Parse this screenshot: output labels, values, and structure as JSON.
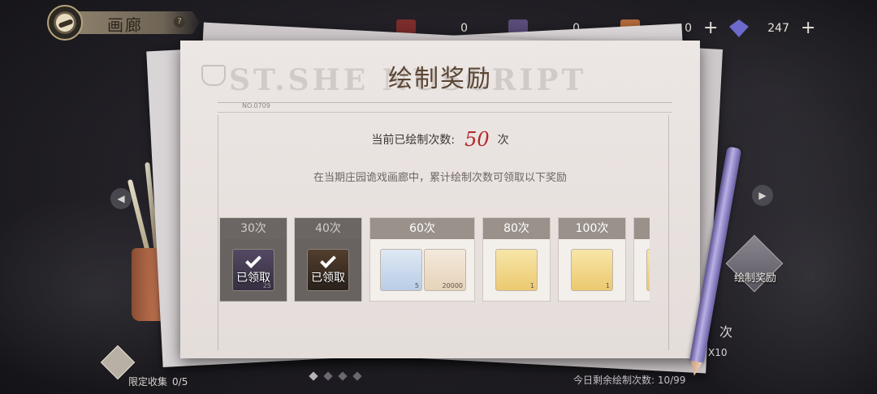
{
  "header": {
    "title": "画廊",
    "help_label": "?"
  },
  "currencies": [
    {
      "icon": "red-box-icon",
      "value": "0",
      "color": "#7a2d2a"
    },
    {
      "icon": "purple-card-icon",
      "value": "0",
      "color": "#5a4b78"
    },
    {
      "icon": "orange-card-icon",
      "value": "0",
      "color": "#b3693a"
    },
    {
      "icon": "diamond-icon",
      "value": "247",
      "color": "#6c6acd"
    }
  ],
  "plus_label": "+",
  "panel": {
    "watermark": "ST.SHE                  NUSCRIPT",
    "doc_no": "NO.0709",
    "title": "绘制奖励",
    "count_prefix": "当前已绘制次数:",
    "count_value": "50",
    "count_suffix": "次",
    "description": "在当期庄园诡戏画廊中，累计绘制次数可领取以下奖励"
  },
  "rewards": [
    {
      "label": "30次",
      "claimed": true,
      "claimed_label": "已领取",
      "items": [
        {
          "icon": "purple-item-icon",
          "qty": "25"
        }
      ]
    },
    {
      "label": "40次",
      "claimed": true,
      "claimed_label": "已领取",
      "items": [
        {
          "icon": "portrait-item-icon",
          "qty": ""
        }
      ]
    },
    {
      "label": "60次",
      "claimed": false,
      "items": [
        {
          "icon": "blue-gift-box-icon",
          "qty": "5"
        },
        {
          "icon": "gold-ring-icon",
          "qty": "20000"
        }
      ]
    },
    {
      "label": "80次",
      "claimed": false,
      "items": [
        {
          "icon": "red-gift-box-icon",
          "qty": "1"
        }
      ]
    },
    {
      "label": "100次",
      "claimed": false,
      "items": [
        {
          "icon": "red-gift-box-icon",
          "qty": "1"
        }
      ]
    }
  ],
  "side": {
    "draw_reward_label": "绘制奖励",
    "ci_label": "次",
    "x10_label": "X10"
  },
  "footer": {
    "collection_label": "限定收集",
    "collection_value": "0/5",
    "remaining_label": "今日剩余绘制次数: 10/99"
  }
}
